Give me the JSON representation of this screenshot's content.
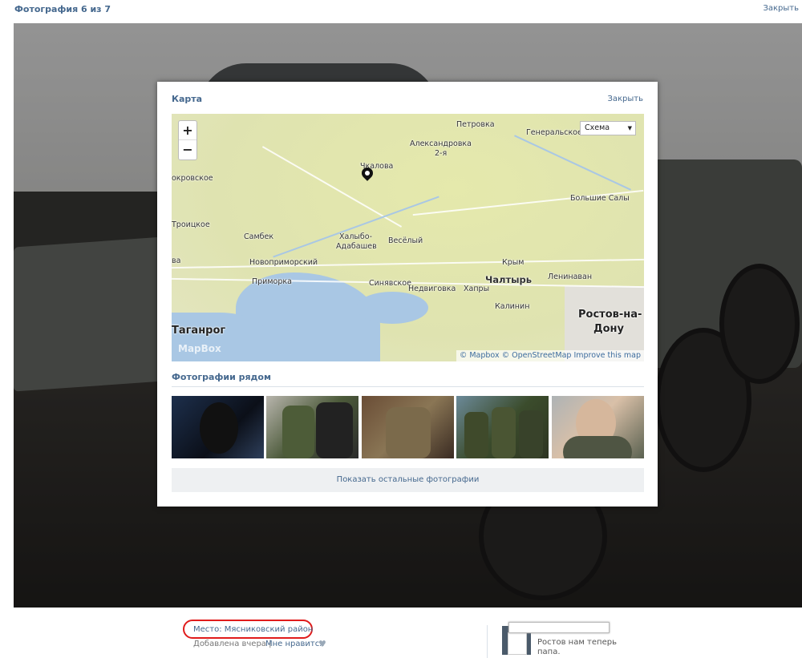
{
  "viewer": {
    "counter": "Фотография 6 из 7",
    "close_label": "Закрыть"
  },
  "modal": {
    "title": "Карта",
    "close_label": "Закрыть",
    "map": {
      "zoom_in": "+",
      "zoom_out": "−",
      "layer_select": "Схема",
      "logo": "MapBox",
      "attribution": [
        "© Mapbox",
        "© OpenStreetMap",
        "Improve this map"
      ],
      "labels": {
        "petrovka": "Петровка",
        "generalskoe": "Генеральское",
        "aleksandrovka": "Александровка",
        "aleksandrovka2": "2-я",
        "chkalova": "Чкалова",
        "pokrovskoe": "окровское",
        "bolshie_saly": "Большие Салы",
        "troitskoe": "Троицкое",
        "sambek": "Самбек",
        "khalybo": "Халыбо-",
        "adabashev": "Адабашев",
        "vesely": "Весёлый",
        "novoprimorsky": "Новоприморский",
        "krym": "Крым",
        "primorka": "Приморка",
        "sinyavskoe": "Синявское",
        "chaltyr": "Чалтырь",
        "leninavan": "Ленинаван",
        "nedvigovka": "Недвиговка",
        "khapry": "Хапры",
        "kalinin": "Калинин",
        "taganrog": "Таганрог",
        "rostov1": "Ростов-на-",
        "rostov2": "Дону",
        "edge_left": "ва"
      }
    },
    "nearby_title": "Фотографии рядом",
    "show_more_label": "Показать остальные фотографии"
  },
  "info": {
    "place_label": "Место: Мясниковский район",
    "added_label": "Добавлена вчера",
    "separator": "|",
    "like_label": "Мне нравится",
    "heart_icon": "heart-icon"
  },
  "comment": {
    "text": "Ростов нам теперь папа."
  },
  "colors": {
    "link": "#45688e",
    "highlight": "#e01b1b",
    "water": "#a9c7e4",
    "land": "#e5e9ac"
  }
}
